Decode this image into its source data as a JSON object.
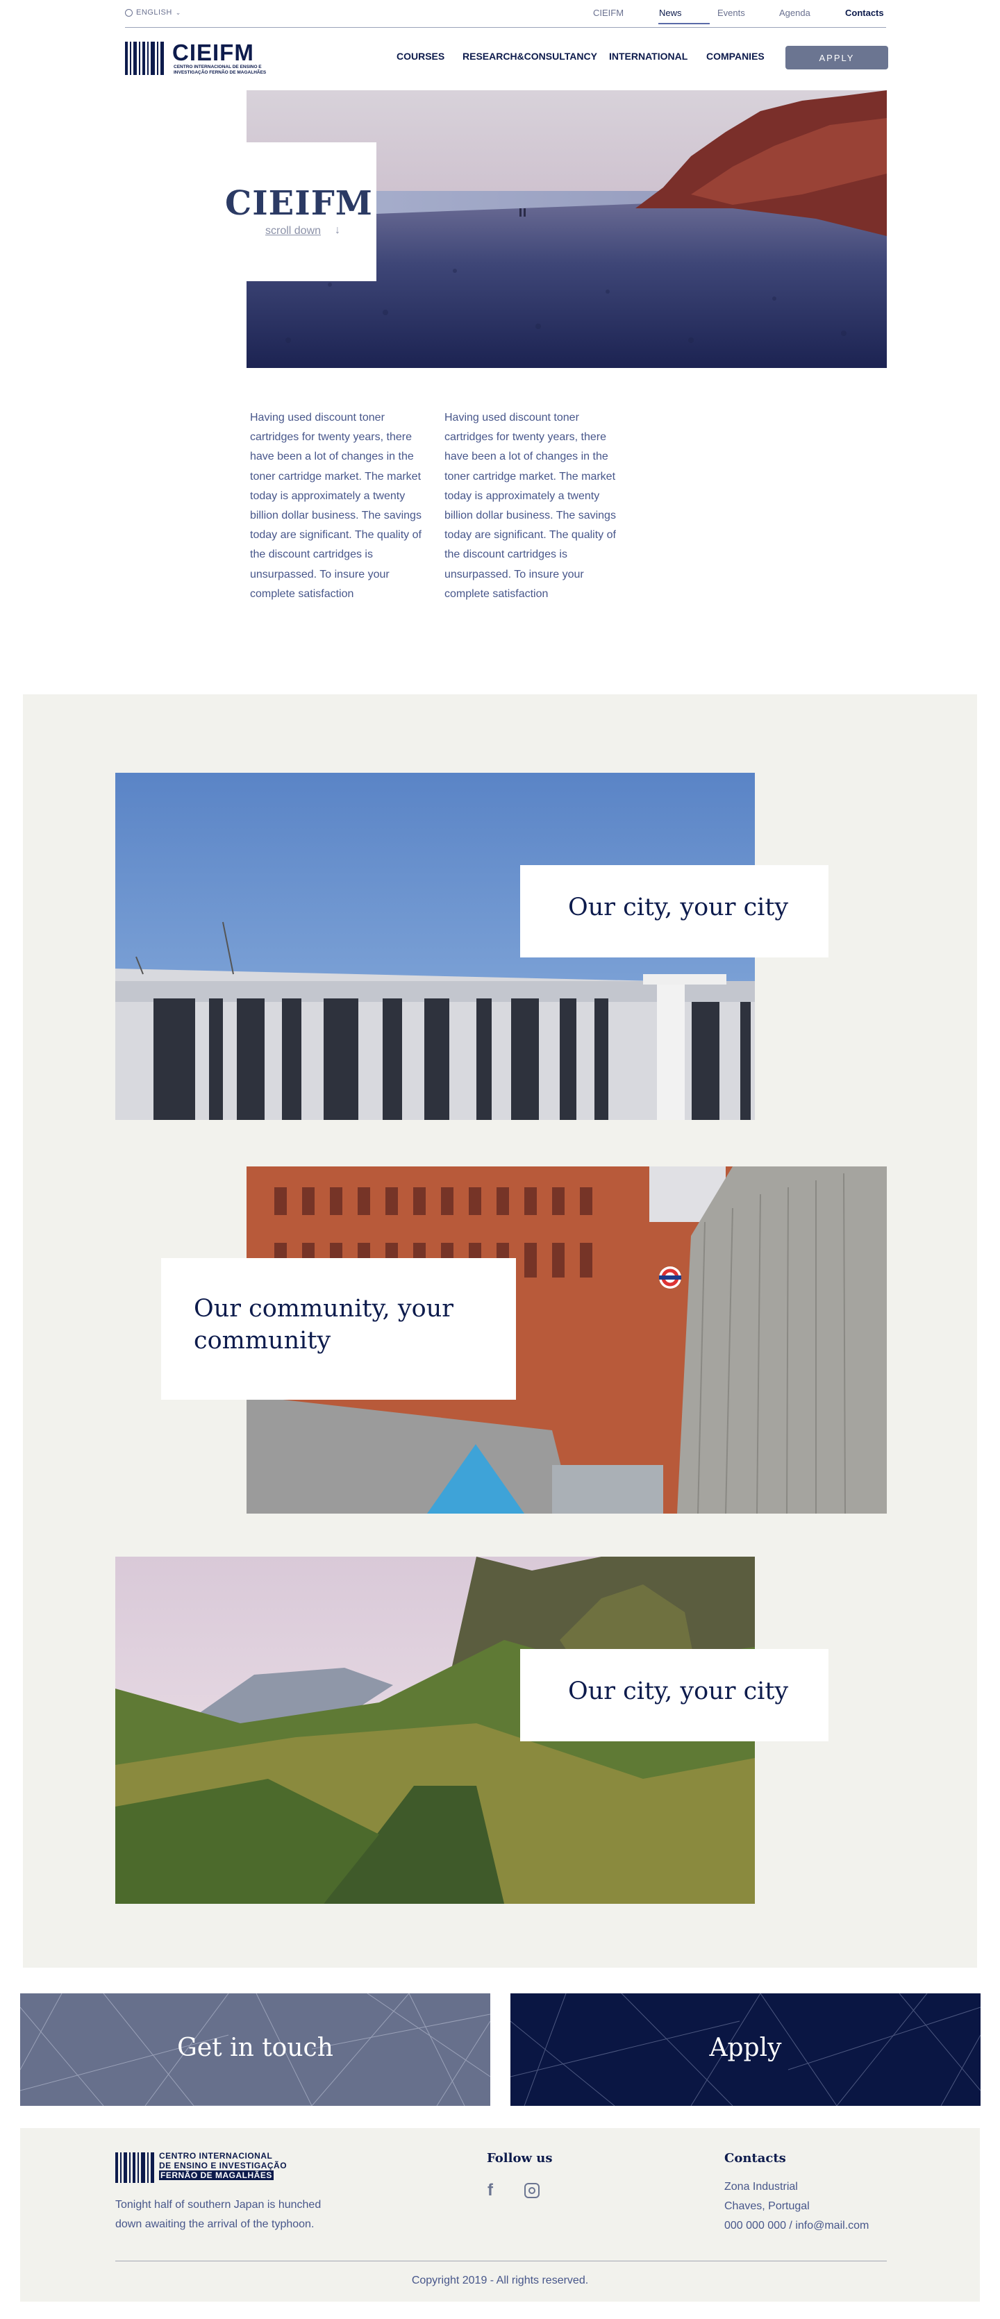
{
  "topbar": {
    "language": "ENGLISH",
    "links": [
      "CIEIFM",
      "News",
      "Events",
      "Agenda",
      "Contacts"
    ]
  },
  "header": {
    "logo_word": "CIEIFM",
    "logo_sub": "CENTRO INTERNACIONAL DE ENSINO E INVESTIGAÇÃO FERNÃO DE MAGALHÃES",
    "nav": [
      "COURSES",
      "RESEARCH&CONSULTANCY",
      "INTERNATIONAL",
      "COMPANIES"
    ],
    "apply": "APPLY"
  },
  "hero": {
    "title": "CIEIFM",
    "scroll": "scroll down"
  },
  "intro": {
    "col1": "Having used discount toner cartridges for twenty years, there have been a lot of changes in the toner cartridge market. The market today is approximately a twenty billion dollar business. The savings today are significant. The quality of the discount cartridges is unsurpassed. To insure your complete satisfaction",
    "col2": "Having used discount toner cartridges for twenty years, there have been a lot of changes in the toner cartridge market. The market today is approximately a twenty billion dollar business. The savings today are significant. The quality of the discount cartridges is unsurpassed. To insure your complete satisfaction"
  },
  "sections": [
    {
      "title": "Our city, your city"
    },
    {
      "title": "Our community, your community"
    },
    {
      "title": "Our city, your city"
    }
  ],
  "cta": {
    "left": "Get in touch",
    "right": "Apply",
    "left_color": "#67708c",
    "right_color": "#0a1643"
  },
  "footer": {
    "logo_lines": [
      "CENTRO INTERNACIONAL",
      "DE ENSINO E INVESTIGAÇÃO",
      "FERNÃO DE MAGALHÃES"
    ],
    "tagline": "Tonight half of southern Japan is hunched down awaiting the arrival of the typhoon.",
    "follow_title": "Follow us",
    "contacts_title": "Contacts",
    "contacts": [
      "Zona Industrial",
      "Chaves, Portugal",
      "000 000 000 / info@mail.com"
    ],
    "copyright": "Copyright 2019 - All rights reserved."
  },
  "colors": {
    "navy": "#0d1b4c",
    "slate": "#67708c",
    "body_text": "#47568a",
    "section_bg": "#f2f2ed"
  }
}
